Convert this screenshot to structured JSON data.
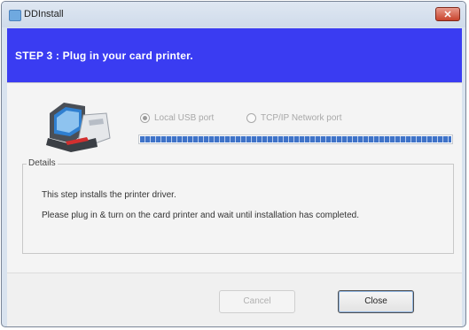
{
  "window": {
    "title": "DDInstall",
    "close_label": "✕"
  },
  "banner": {
    "text": "STEP 3 : Plug in your card printer."
  },
  "connection": {
    "options": [
      {
        "label": "Local USB port",
        "selected": true
      },
      {
        "label": "TCP/IP Network port",
        "selected": false
      }
    ],
    "progress": 1.0
  },
  "details": {
    "legend": "Details",
    "lines": [
      "This step installs the printer driver.",
      "Please plug in & turn on the card printer and wait until installation has completed."
    ]
  },
  "buttons": {
    "cancel": "Cancel",
    "close": "Close"
  },
  "colors": {
    "banner": "#3a3cf2",
    "progress": "#3f73c8"
  }
}
